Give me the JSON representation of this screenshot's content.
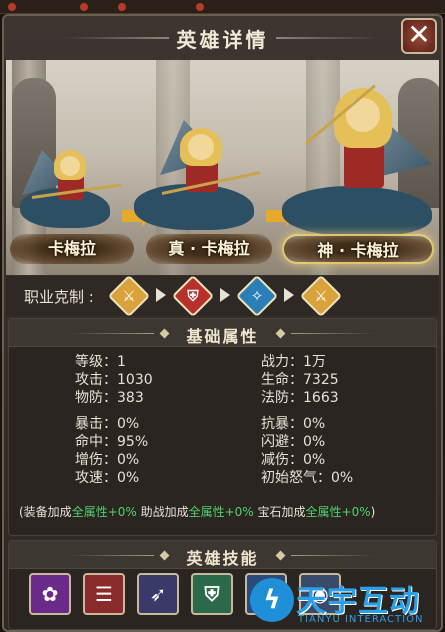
{
  "window": {
    "title": "英雄详情",
    "close_symbol": "✕"
  },
  "evolution": {
    "stages": [
      {
        "name": "卡梅拉",
        "tier": "base"
      },
      {
        "name": "真 · 卡梅拉",
        "tier": "true"
      },
      {
        "name": "神 · 卡梅拉",
        "tier": "god"
      }
    ],
    "arrow_color": "#e7a92a"
  },
  "class_counter": {
    "label": "职业克制 :",
    "icons": [
      {
        "name": "lance-class-icon",
        "glyph": "⚔",
        "color": "#d9a23a"
      },
      {
        "name": "shield-class-icon",
        "glyph": "⛨",
        "color": "#b8302a"
      },
      {
        "name": "magic-class-icon",
        "glyph": "✧",
        "color": "#2a7fb8"
      },
      {
        "name": "lance-class-icon-2",
        "glyph": "⚔",
        "color": "#d9a23a"
      }
    ]
  },
  "base_attributes": {
    "title": "基础属性",
    "left": [
      "等级：1",
      "攻击：1030",
      "物防：383",
      "暴击：0%",
      "命中：95%",
      "增伤：0%",
      "攻速：0%"
    ],
    "right": [
      "战力：1万",
      "生命：7325",
      "法防：1663",
      "抗暴：0%",
      "闪避：0%",
      "减伤：0%",
      "初始怒气：0%"
    ],
    "bonus": {
      "p1": "(装备加成",
      "g1": "全属性+0%",
      "p2": " 助战加成",
      "g2": "全属性+0%",
      "p3": " 宝石加成",
      "g3": "全属性+0%",
      "p4": ")"
    }
  },
  "skills": {
    "title": "英雄技能",
    "items": [
      {
        "name": "skill-1-icon",
        "glyph": "✿",
        "color": "#6a2a8a"
      },
      {
        "name": "skill-2-icon",
        "glyph": "☰",
        "color": "#8a2a2a"
      },
      {
        "name": "skill-3-icon",
        "glyph": "➶",
        "color": "#3a3a6a"
      },
      {
        "name": "skill-4-icon",
        "glyph": "⛨",
        "color": "#2a6a4a"
      },
      {
        "name": "skill-5-icon",
        "glyph": "✦",
        "color": "#2a4a7a"
      },
      {
        "name": "skill-6-icon",
        "glyph": "◉",
        "color": "#3a4a6a"
      }
    ]
  },
  "watermark": {
    "text": "天宇互动",
    "sub": "TIANYU INTERACTION",
    "logo_glyph": "ϟ"
  }
}
